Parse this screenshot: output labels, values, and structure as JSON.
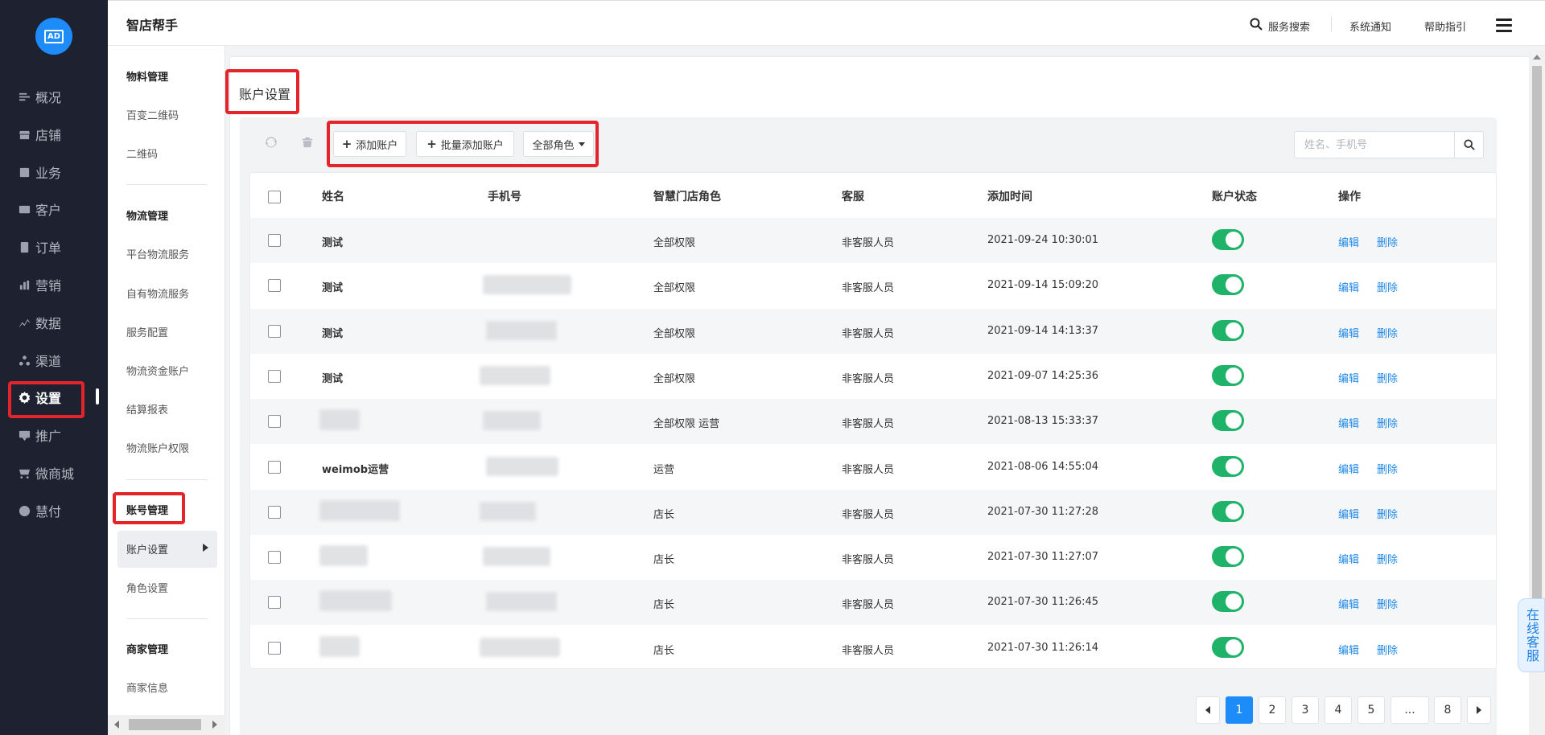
{
  "nav": {
    "logo": "AD",
    "items": [
      {
        "label": "概况",
        "icon": "overview-icon"
      },
      {
        "label": "店铺",
        "icon": "store-icon"
      },
      {
        "label": "业务",
        "icon": "business-icon"
      },
      {
        "label": "客户",
        "icon": "customer-icon"
      },
      {
        "label": "订单",
        "icon": "order-icon"
      },
      {
        "label": "营销",
        "icon": "marketing-icon"
      },
      {
        "label": "数据",
        "icon": "data-icon"
      },
      {
        "label": "渠道",
        "icon": "channel-icon"
      },
      {
        "label": "设置",
        "icon": "settings-icon",
        "active": true
      },
      {
        "label": "推广",
        "icon": "promotion-icon"
      },
      {
        "label": "微商城",
        "icon": "mall-icon"
      },
      {
        "label": "慧付",
        "icon": "pay-icon"
      }
    ]
  },
  "header": {
    "brand": "智店帮手",
    "search": "服务搜索",
    "notify": "系统通知",
    "help": "帮助指引"
  },
  "subnav": {
    "groups": [
      {
        "title": "物料管理",
        "items": [
          "百变二维码",
          "二维码"
        ]
      },
      {
        "title": "物流管理",
        "items": [
          "平台物流服务",
          "自有物流服务",
          "服务配置",
          "物流资金账户",
          "结算报表",
          "物流账户权限"
        ]
      },
      {
        "title": "账号管理",
        "items": [
          "账户设置",
          "角色设置"
        ]
      },
      {
        "title": "商家管理",
        "items": [
          "商家信息"
        ]
      }
    ]
  },
  "page": {
    "title": "账户设置",
    "toolbar": {
      "add": "添加账户",
      "batch_add": "批量添加账户",
      "role_filter": "全部角色"
    },
    "search_placeholder": "姓名、手机号"
  },
  "table": {
    "headers": [
      "姓名",
      "手机号",
      "智慧门店角色",
      "客服",
      "添加时间",
      "账户状态",
      "操作"
    ],
    "actions": {
      "edit": "编辑",
      "delete": "删除"
    },
    "rows": [
      {
        "name": "测试",
        "role": "全部权限",
        "service": "非客服人员",
        "time": "2021-09-24 10:30:01"
      },
      {
        "name": "测试",
        "role": "全部权限",
        "service": "非客服人员",
        "time": "2021-09-14 15:09:20"
      },
      {
        "name": "测试",
        "role": "全部权限",
        "service": "非客服人员",
        "time": "2021-09-14 14:13:37"
      },
      {
        "name": "测试",
        "role": "全部权限",
        "service": "非客服人员",
        "time": "2021-09-07 14:25:36"
      },
      {
        "name": "",
        "role": "全部权限  运营",
        "service": "非客服人员",
        "time": "2021-08-13 15:33:37"
      },
      {
        "name": "weimob运营",
        "role": "运营",
        "service": "非客服人员",
        "time": "2021-08-06 14:55:04"
      },
      {
        "name": "",
        "role": "店长",
        "service": "非客服人员",
        "time": "2021-07-30 11:27:28"
      },
      {
        "name": "",
        "role": "店长",
        "service": "非客服人员",
        "time": "2021-07-30 11:27:07"
      },
      {
        "name": "",
        "role": "店长",
        "service": "非客服人员",
        "time": "2021-07-30 11:26:45"
      },
      {
        "name": "",
        "role": "店长",
        "service": "非客服人员",
        "time": "2021-07-30 11:26:14"
      }
    ]
  },
  "pagination": {
    "pages": [
      "1",
      "2",
      "3",
      "4",
      "5",
      "...",
      "8"
    ],
    "current": "1"
  },
  "online_service": "在线客服",
  "colors": {
    "accent": "#1d8cf8",
    "switch_on": "#1fb36a",
    "highlight": "#e3242b",
    "nav_bg": "#1e2230"
  }
}
